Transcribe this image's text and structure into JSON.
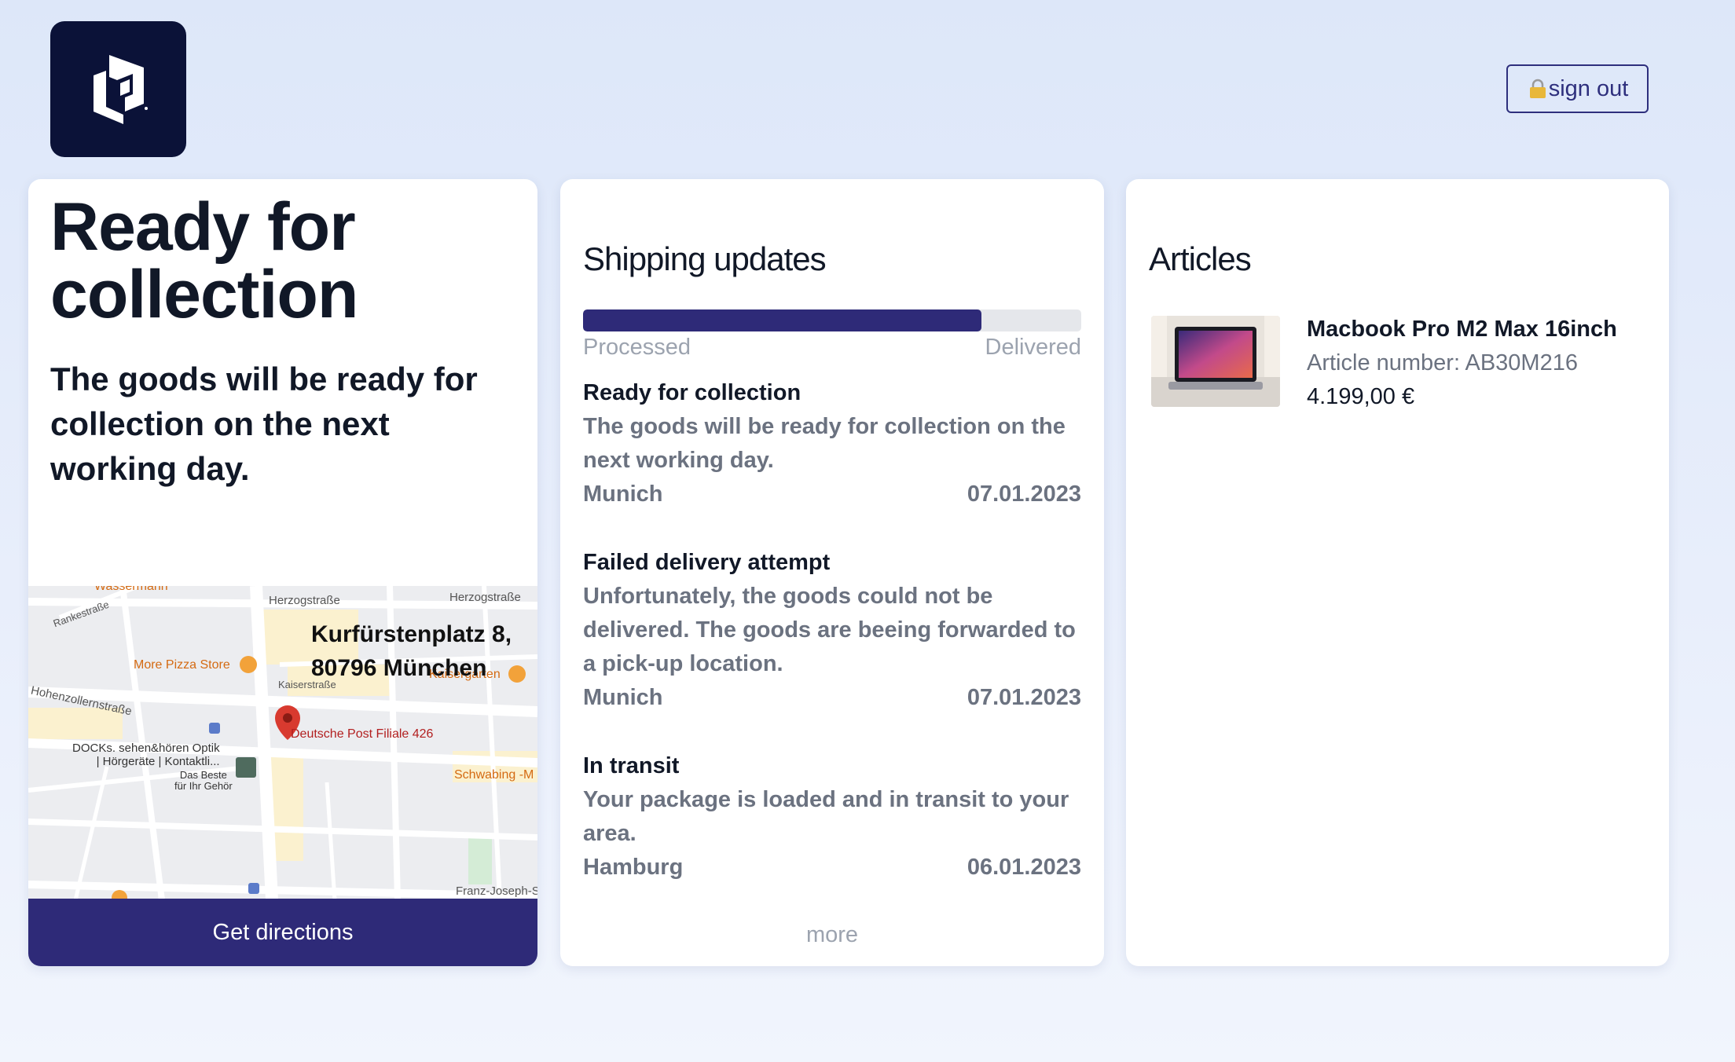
{
  "header": {
    "logo_icon": "box-logo-icon",
    "signout_icon": "lock-icon",
    "signout_label": "sign out"
  },
  "pickup": {
    "title": "Ready for collection",
    "subtitle": "The goods will be ready for collection on the next working day.",
    "address": "Kurfürstenplatz 8, 80796 München",
    "map_labels": {
      "street_herzog1": "Herzogstraße",
      "street_herzog2": "Herzogstraße",
      "street_ranke": "Rankestraße",
      "street_hohenzollern": "Hohenzollernstraße",
      "street_kaiser": "Kaiserstraße",
      "street_franz": "Franz-Joseph-S",
      "poi_wassermann": "Wassermann",
      "poi_pizza": "More Pizza Store",
      "poi_kaisergarten": "Kaisergarten",
      "poi_post": "Deutsche Post Filiale 426",
      "poi_docks": "DOCKs. sehen&hören Optik\n| Hörgeräte | Kontaktli...",
      "poi_docks_sub": "Das Beste\nfür Ihr Gehör",
      "poi_schwabing": "Schwabing -M"
    },
    "directions_label": "Get directions"
  },
  "shipping": {
    "title": "Shipping updates",
    "progress_percent": 80,
    "progress_start": "Processed",
    "progress_end": "Delivered",
    "updates": [
      {
        "title": "Ready for collection",
        "text": "The goods will be ready for collection on the next working day.",
        "location": "Munich",
        "date": "07.01.2023"
      },
      {
        "title": "Failed delivery attempt",
        "text": "Unfortunately, the goods could not be delivered. The goods are beeing forwarded to a pick-up location.",
        "location": "Munich",
        "date": "07.01.2023"
      },
      {
        "title": "In transit",
        "text": "Your package is loaded and in transit to your area.",
        "location": "Hamburg",
        "date": "06.01.2023"
      }
    ],
    "more_label": "more"
  },
  "articles": {
    "title": "Articles",
    "items": [
      {
        "name": "Macbook Pro M2 Max 16inch",
        "article_number": "Article number: AB30M216",
        "price": "4.199,00 €"
      }
    ]
  },
  "colors": {
    "brand": "#2e2a78",
    "logo_bg": "#0b1238",
    "muted": "#6b7280"
  }
}
